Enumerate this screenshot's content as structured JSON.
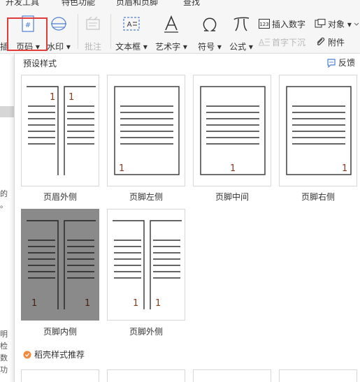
{
  "menu": {
    "tabs": [
      "开发工具",
      "特色功能",
      "页眉和页脚",
      "查找"
    ]
  },
  "ribbon": {
    "page_number_label": "页码",
    "watermark_label": "水印",
    "annotation_label": "批注",
    "textbox_label": "文本框",
    "wordart_label": "艺术字",
    "symbol_label": "符号",
    "formula_label": "公式",
    "insert_number_label": "插入数字",
    "object_label": "对象",
    "dropcap_label": "首字下沉",
    "attachment_label": "附件",
    "edge_char": "插"
  },
  "doc_snippets": [
    "的",
    "。",
    "明",
    "检",
    "数",
    "功"
  ],
  "panel": {
    "title": "预设样式",
    "feedback_label": "反馈",
    "presets": [
      {
        "label": "页眉外侧",
        "digit": "1"
      },
      {
        "label": "页脚左侧",
        "digit": "1"
      },
      {
        "label": "页脚中间",
        "digit": "1"
      },
      {
        "label": "页脚右侧",
        "digit": "1"
      },
      {
        "label": "页脚内侧",
        "digit": "1"
      },
      {
        "label": "页脚外侧",
        "digit": "1"
      }
    ],
    "recommend_title": "稻壳样式推荐"
  },
  "colors": {
    "highlight": "#e03c3c",
    "number": "#8b3a1a",
    "selected_bg": "#8a8a8a",
    "accent_blue": "#4a7fd4"
  }
}
